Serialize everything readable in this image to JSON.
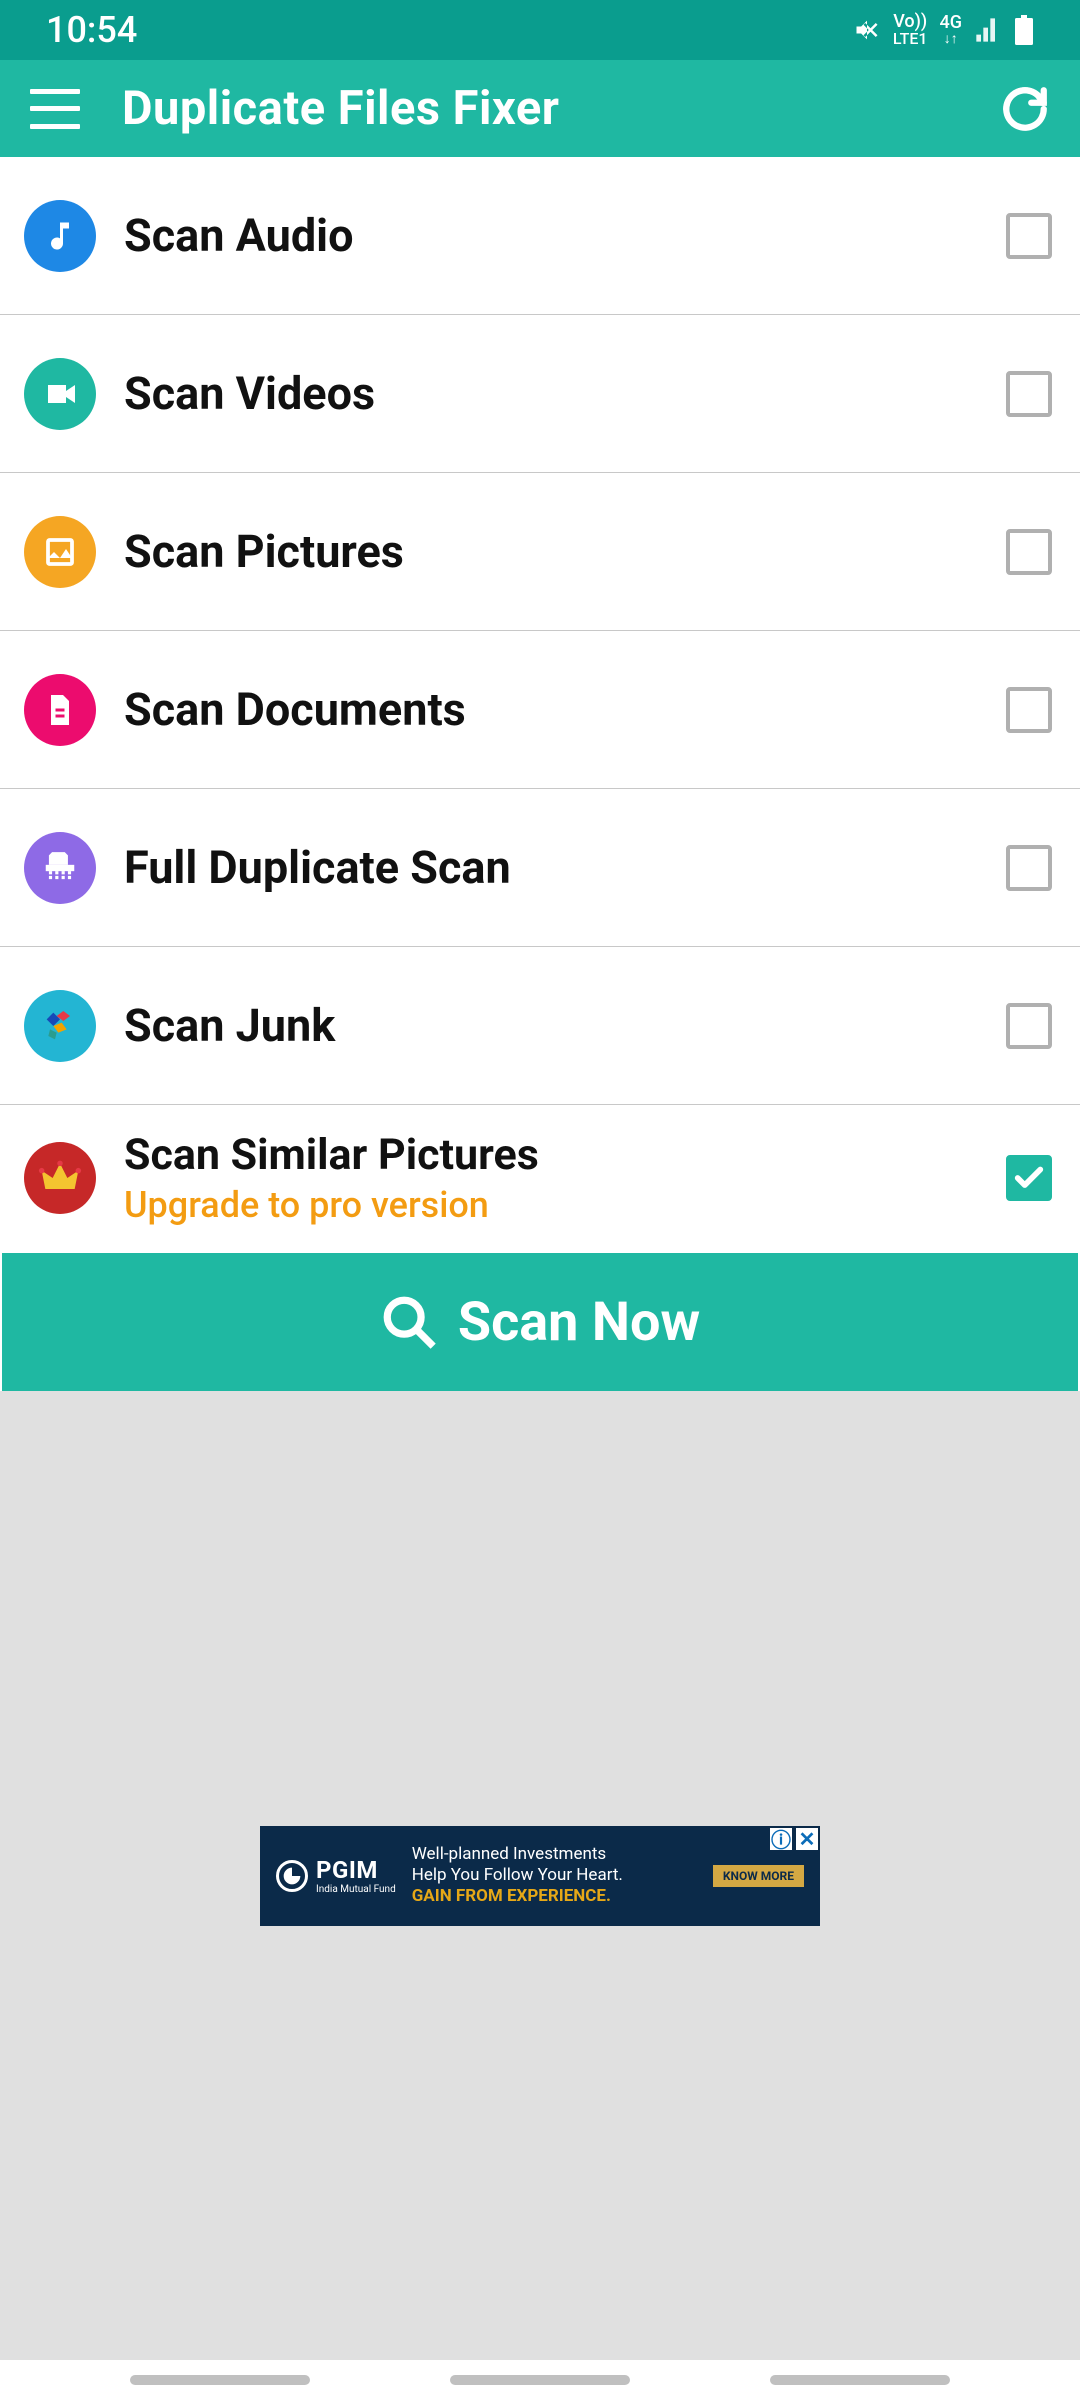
{
  "status": {
    "time": "10:54",
    "indicators": {
      "volte": "Vo))",
      "lte": "LTE1",
      "net": "4G"
    }
  },
  "appbar": {
    "title": "Duplicate Files Fixer"
  },
  "scan_options": [
    {
      "key": "audio",
      "label": "Scan Audio",
      "icon": "music-note-icon",
      "color": "c-blue",
      "checked": false
    },
    {
      "key": "videos",
      "label": "Scan Videos",
      "icon": "video-icon",
      "color": "c-teal",
      "checked": false
    },
    {
      "key": "pictures",
      "label": "Scan Pictures",
      "icon": "image-icon",
      "color": "c-amber",
      "checked": false
    },
    {
      "key": "documents",
      "label": "Scan Documents",
      "icon": "document-icon",
      "color": "c-pink",
      "checked": false
    },
    {
      "key": "full",
      "label": "Full Duplicate Scan",
      "icon": "shredder-icon",
      "color": "c-purple",
      "checked": false
    },
    {
      "key": "junk",
      "label": "Scan Junk",
      "icon": "junk-icon",
      "color": "c-cyan",
      "checked": false
    },
    {
      "key": "similar",
      "label": "Scan Similar Pictures",
      "icon": "crown-icon",
      "color": "c-red",
      "checked": true,
      "sub": "Upgrade to pro version"
    }
  ],
  "scan_button": "Scan Now",
  "ad": {
    "brand": "PGIM",
    "brand_sub": "India Mutual Fund",
    "line1": "Well-planned Investments",
    "line2": "Help You Follow Your Heart.",
    "line3": "GAIN FROM EXPERIENCE.",
    "cta": "KNOW MORE"
  }
}
